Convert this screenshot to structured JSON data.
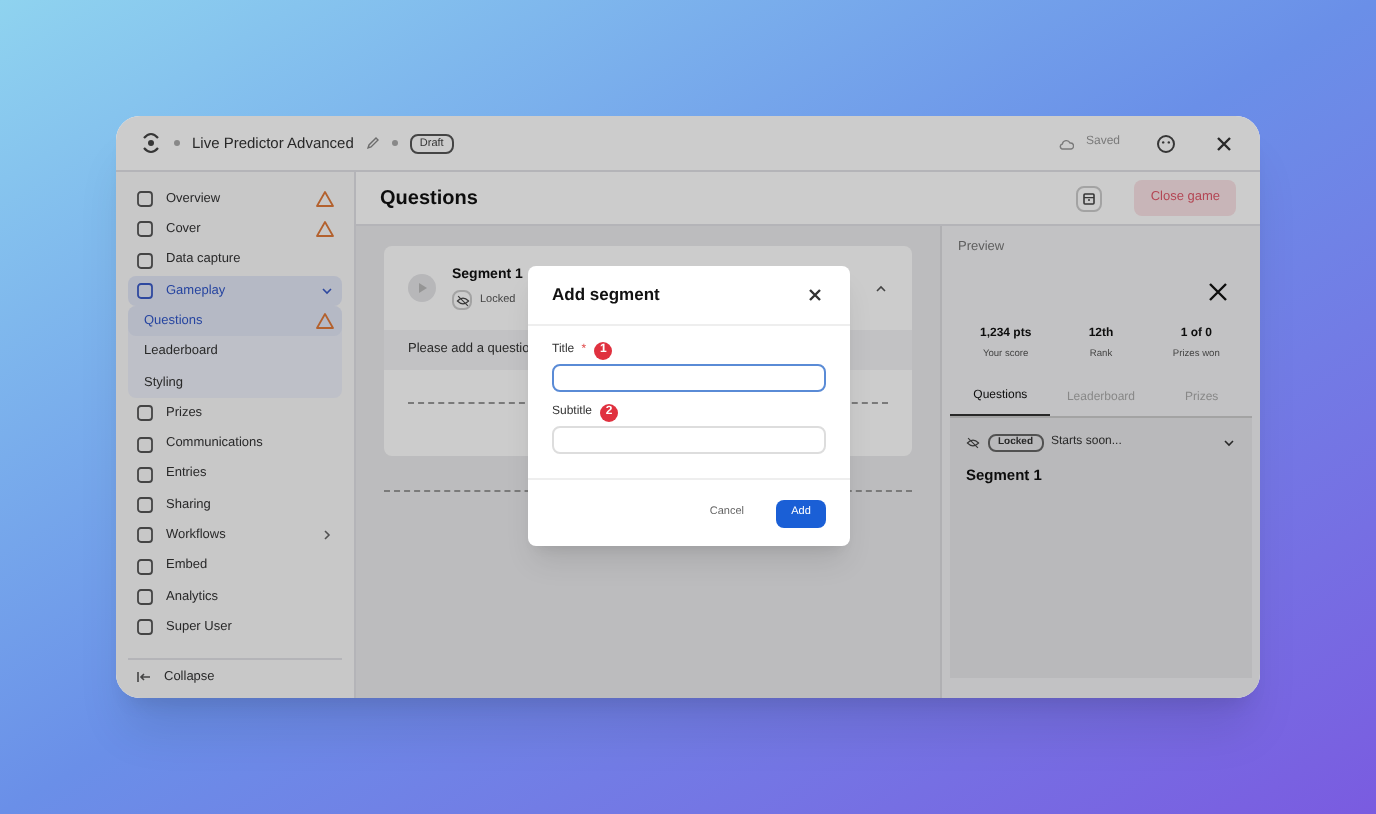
{
  "title_bar": {
    "project": "Live Predictor Advanced",
    "status": "Draft",
    "saved": "Saved"
  },
  "sidebar": {
    "items": [
      {
        "label": "Overview",
        "warning": true,
        "selected": false
      },
      {
        "label": "Cover",
        "warning": true,
        "selected": false
      },
      {
        "label": "Data capture",
        "warning": false,
        "selected": false
      },
      {
        "label": "Gameplay",
        "warning": false,
        "selected": true,
        "expanded": true,
        "children": [
          {
            "label": "Questions",
            "warning": true,
            "selected": true
          },
          {
            "label": "Leaderboard",
            "warning": false,
            "selected": false
          },
          {
            "label": "Styling",
            "warning": false,
            "selected": false
          }
        ]
      },
      {
        "label": "Prizes",
        "warning": false,
        "selected": false
      },
      {
        "label": "Communications",
        "warning": false,
        "selected": false
      },
      {
        "label": "Entries",
        "warning": false,
        "selected": false
      },
      {
        "label": "Sharing",
        "warning": false,
        "selected": false
      },
      {
        "label": "Workflows",
        "warning": false,
        "selected": false,
        "expanded": false
      },
      {
        "label": "Embed",
        "warning": false,
        "selected": false
      },
      {
        "label": "Analytics",
        "warning": false,
        "selected": false
      },
      {
        "label": "Super User",
        "warning": false,
        "selected": false
      }
    ],
    "collapse": "Collapse"
  },
  "header": {
    "title": "Questions",
    "close_game": "Close game"
  },
  "segment_card": {
    "title": "Segment 1",
    "locked": "Locked",
    "message": "Please add a questio"
  },
  "preview": {
    "label": "Preview",
    "stats": [
      {
        "value": "1,234 pts",
        "label": "Your score"
      },
      {
        "value": "12th",
        "label": "Rank"
      },
      {
        "value": "1 of 0",
        "label": "Prizes won"
      }
    ],
    "tabs": [
      {
        "label": "Questions",
        "selected": true
      },
      {
        "label": "Leaderboard",
        "selected": false
      },
      {
        "label": "Prizes",
        "selected": false
      }
    ],
    "segment": {
      "badge": "Locked",
      "status": "Starts soon...",
      "title": "Segment 1"
    }
  },
  "modal": {
    "title": "Add segment",
    "fields": [
      {
        "label": "Title",
        "required_mark": "*",
        "step": "1",
        "focused": true
      },
      {
        "label": "Subtitle",
        "step": "2",
        "focused": false
      }
    ],
    "buttons": {
      "cancel": "Cancel",
      "add": "Add"
    }
  }
}
